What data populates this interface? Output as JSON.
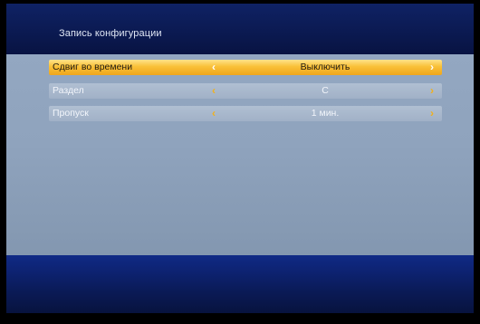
{
  "header": {
    "title": "Запись конфигурации"
  },
  "settings": {
    "rows": [
      {
        "label": "Сдвиг во времени",
        "value": "Выключить",
        "selected": true
      },
      {
        "label": "Раздел",
        "value": "C",
        "selected": false
      },
      {
        "label": "Пропуск",
        "value": "1 мин.",
        "selected": false
      }
    ],
    "arrow_left_glyph": "‹",
    "arrow_right_glyph": "›"
  },
  "colors": {
    "header_bg": "#0b1a52",
    "body_bg": "#8fa3bd",
    "footer_bg": "#0d2270",
    "selected_row": "#f9c037",
    "row_bg": "#a1b1c7",
    "arrow_accent": "#f2b11a"
  },
  "icons": {
    "left": "chevron-left-icon",
    "right": "chevron-right-icon"
  }
}
